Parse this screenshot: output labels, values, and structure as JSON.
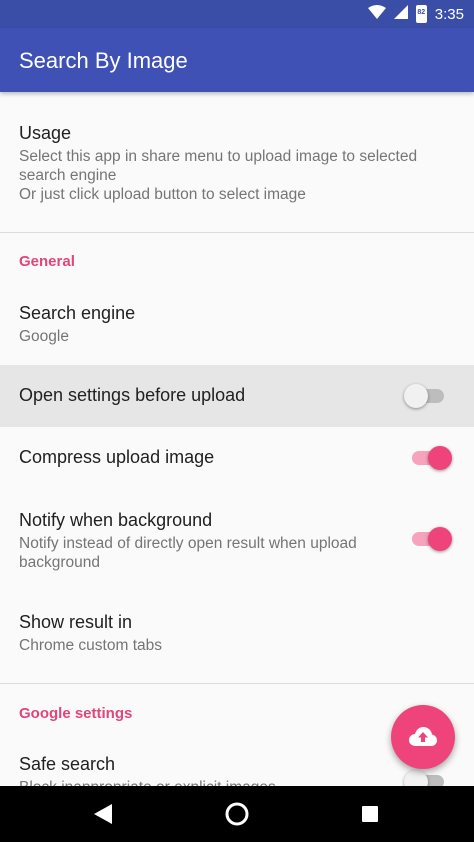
{
  "status_bar": {
    "time": "3:35",
    "battery_label": "82",
    "icons": [
      "wifi-icon",
      "signal-icon",
      "battery-icon"
    ]
  },
  "app_bar": {
    "title": "Search By Image"
  },
  "usage": {
    "title": "Usage",
    "summary_line1": "Select this app in share menu to upload image to selected",
    "summary_line2": "search engine",
    "summary_line3": "Or just click upload button to select image"
  },
  "general": {
    "header": "General",
    "search_engine": {
      "title": "Search engine",
      "value": "Google"
    },
    "open_settings": {
      "title": "Open settings before upload",
      "enabled": false
    },
    "compress": {
      "title": "Compress upload image",
      "enabled": true
    },
    "notify": {
      "title": "Notify when background",
      "summary_line1": "Notify instead of directly open result when upload",
      "summary_line2": "background",
      "enabled": true
    },
    "show_result": {
      "title": "Show result in",
      "value": "Chrome custom tabs"
    }
  },
  "google_settings": {
    "header": "Google settings",
    "safe_search": {
      "title": "Safe search",
      "summary": "Block inappropriate or explicit images",
      "enabled": false
    }
  },
  "fab": {
    "icon": "cloud-upload-icon"
  },
  "nav_bar": {
    "icons": [
      "back-icon",
      "home-icon",
      "recents-icon"
    ]
  },
  "colors": {
    "primary": "#3f51b5",
    "primary_dark": "#3a4ea8",
    "accent": "#ef447b",
    "category_text": "#e0457b",
    "pressed_row": "#e6e6e6"
  }
}
